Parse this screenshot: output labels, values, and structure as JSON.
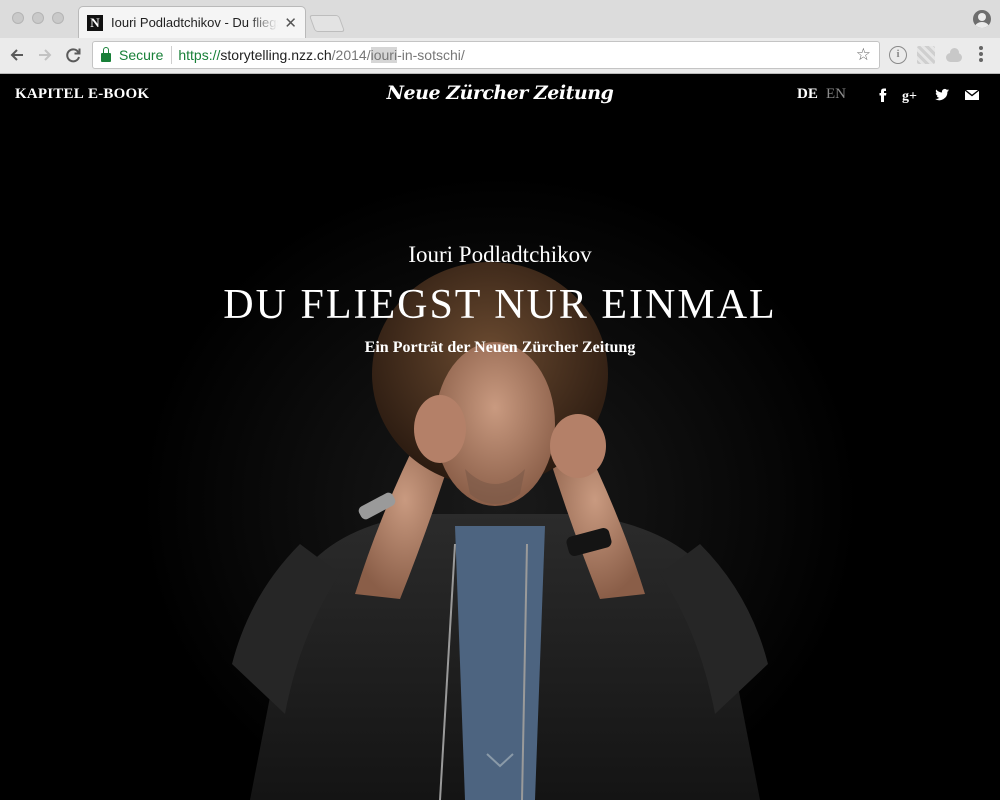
{
  "browser": {
    "tab_title": "Iouri Podladtchikov - Du fliegst nur einmal",
    "tab_favicon": "N",
    "close_symbol": "✕",
    "url": {
      "secure_label": "Secure",
      "scheme": "https://",
      "host": "storytelling.nzz.ch",
      "path_before": "/2014/",
      "path_highlight": "iouri",
      "path_after": "-in-sotschi/"
    },
    "icons": [
      "back-arrow-icon",
      "forward-arrow-icon",
      "reload-icon",
      "lock-icon",
      "star-icon",
      "info-icon",
      "extension-icon",
      "cloud-icon",
      "menu-icon",
      "profile-icon"
    ]
  },
  "main": {
    "nav": {
      "kapitel": "KAPITEL",
      "ebook": "E-BOOK"
    },
    "masthead": "Neue Zürcher Zeitung",
    "langs": {
      "de": "DE",
      "en": "EN"
    },
    "social_icons": [
      "facebook-icon",
      "google-plus-icon",
      "twitter-icon",
      "mail-icon"
    ],
    "hero": {
      "name": "Iouri Podladtchikov",
      "title": "DU FLIEGST NUR EINMAL",
      "subtitle": "Ein Porträt der Neuen Zürcher Zeitung"
    }
  },
  "colors": {
    "background": "#000000",
    "text": "#ffffff",
    "inactive_lang": "#8a8a8a",
    "secure_green": "#188038"
  }
}
